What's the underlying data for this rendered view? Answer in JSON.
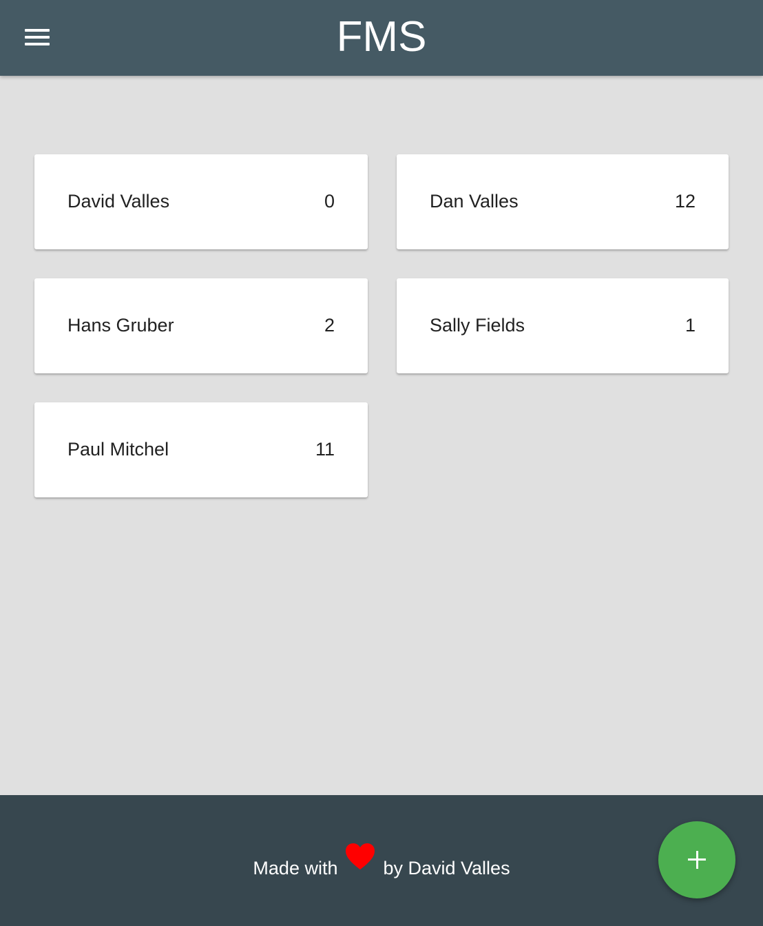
{
  "header": {
    "title": "FMS",
    "menu_icon": "menu-icon"
  },
  "players": [
    {
      "name": "David Valles",
      "count": "0"
    },
    {
      "name": "Dan Valles",
      "count": "12"
    },
    {
      "name": "Hans Gruber",
      "count": "2"
    },
    {
      "name": "Sally Fields",
      "count": "1"
    },
    {
      "name": "Paul Mitchel",
      "count": "11"
    }
  ],
  "footer": {
    "prefix": "Made with",
    "suffix": "by David Valles",
    "heart_icon": "heart-icon",
    "heart_color": "#ff0000"
  },
  "fab": {
    "icon": "plus-icon",
    "color": "#4caf50"
  },
  "colors": {
    "app_bar": "#455a64",
    "footer": "#37474f",
    "background": "#e0e0e0"
  }
}
